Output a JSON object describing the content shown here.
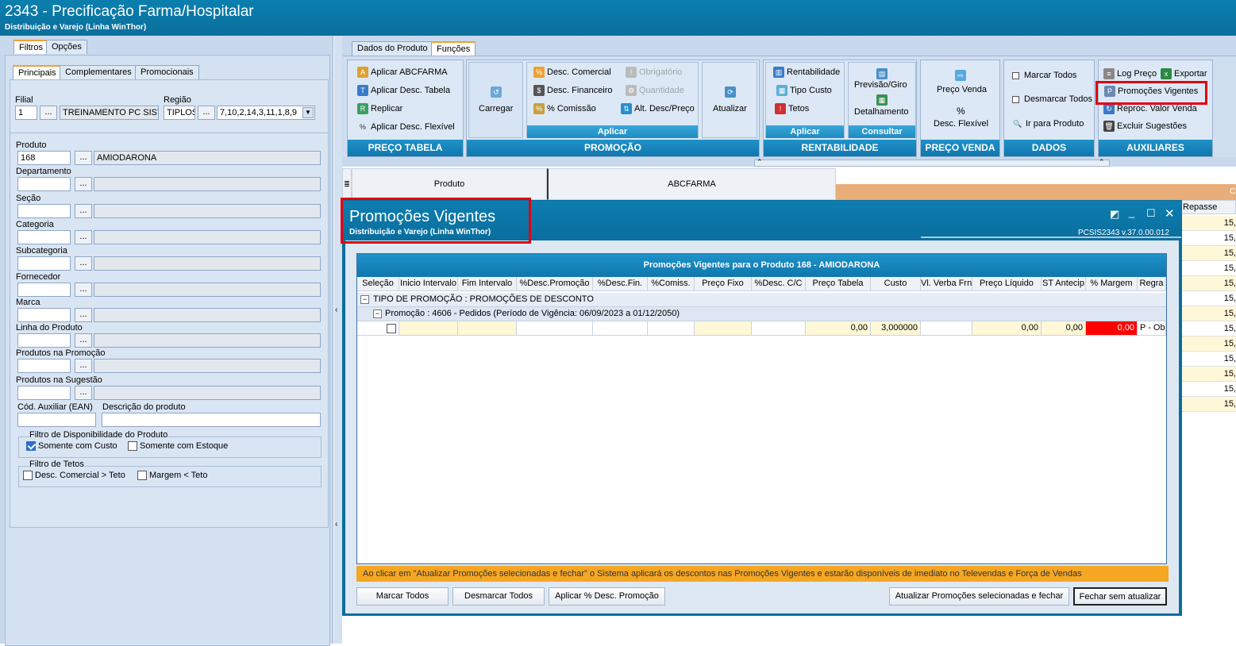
{
  "window": {
    "title": "2343 - Precificação Farma/Hospitalar",
    "subtitle": "Distribuição e Varejo (Linha WinThor)"
  },
  "left": {
    "top_tabs": [
      "Filtros",
      "Opções"
    ],
    "sub_tabs": [
      "Principais",
      "Complementares",
      "Promocionais"
    ],
    "filial_label": "Filial",
    "filial_value": "1",
    "filial_name": "TREINAMENTO PC SISTEI",
    "regiao_label": "Região",
    "regiao_value": "TIPLOS",
    "regiao_list": "7,10,2,14,3,11,1,8,9",
    "fields": [
      {
        "label": "Produto",
        "code": "168",
        "desc": "AMIODARONA"
      },
      {
        "label": "Departamento",
        "code": "",
        "desc": ""
      },
      {
        "label": "Seção",
        "code": "",
        "desc": ""
      },
      {
        "label": "Categoria",
        "code": "",
        "desc": ""
      },
      {
        "label": "Subcategoria",
        "code": "",
        "desc": ""
      },
      {
        "label": "Fornecedor",
        "code": "",
        "desc": ""
      },
      {
        "label": "Marca",
        "code": "",
        "desc": ""
      },
      {
        "label": "Linha do Produto",
        "code": "",
        "desc": ""
      },
      {
        "label": "Produtos na Promoção",
        "code": "",
        "desc": ""
      },
      {
        "label": "Produtos na Sugestão",
        "code": "",
        "desc": ""
      }
    ],
    "ean_label": "Cód. Auxiliar (EAN)",
    "descprod_label": "Descrição do produto",
    "disp_title": "Filtro de Disponibilidade do Produto",
    "disp_custo": "Somente com Custo",
    "disp_estoque": "Somente com Estoque",
    "tetos_title": "Filtro de Tetos",
    "teto_desc": "Desc.  Comercial > Teto",
    "teto_margem": "Margem < Teto",
    "dots": "..."
  },
  "ribbon": {
    "tabs": [
      "Dados do Produto",
      "Funções"
    ],
    "preco_tabela": {
      "footer": "PREÇO TABELA",
      "items": [
        "Aplicar ABCFARMA",
        "Aplicar Desc. Tabela",
        "Replicar",
        "Aplicar Desc. Flexível"
      ]
    },
    "promocao": {
      "footer": "PROMOÇÃO",
      "carregar": "Carregar",
      "sub": "Aplicar",
      "items": [
        "Desc. Comercial",
        "Desc. Financeiro",
        "% Comissão"
      ],
      "items2": [
        "Obrigatório",
        "Quantidade",
        "Alt. Desc/Preço"
      ],
      "atualizar": "Atualizar"
    },
    "rentab": {
      "footer": "RENTABILIDADE",
      "sub": "Aplicar",
      "items": [
        "Rentabilidade",
        "Tipo Custo",
        "Tetos"
      ],
      "sub2": "Consultar",
      "prev": "Previsão/Giro",
      "det": "Detalhamento"
    },
    "preco_venda": {
      "footer": "PREÇO VENDA",
      "items": [
        "Preço Venda",
        "Desc. Flexível"
      ]
    },
    "dados": {
      "footer": "DADOS",
      "items": [
        "Marcar Todos",
        "Desmarcar Todos",
        "Ir para Produto"
      ]
    },
    "aux": {
      "footer": "AUXILIARES",
      "items": [
        "Log Preço",
        "Exportar",
        "Promoções Vigentes",
        "Reproc. Valor Venda",
        "Excluir Sugestões"
      ]
    }
  },
  "grid": {
    "col_produto": "Produto",
    "col_abc": "ABCFARMA",
    "col_repasse": "Repasse",
    "col_c": "C",
    "repasse_values": [
      "15,",
      "15,",
      "15,",
      "15,",
      "15,",
      "15,",
      "15,",
      "15,",
      "15,",
      "15,",
      "15,",
      "15,",
      "15,"
    ]
  },
  "modal": {
    "title": "Promoções Vigentes",
    "subtitle": "Distribuição e Varejo (Linha WinThor)",
    "version": "PCSIS2343  v.37.0.00.012",
    "grid_title": "Promoções Vigentes para o Produto 168 - AMIODARONA",
    "columns": [
      "Seleção",
      "Inicio Intervalo",
      "Fim Intervalo",
      "%Desc.Promoção",
      "%Desc.Fin.",
      "%Comiss.",
      "Preço Fixo",
      "%Desc. C/C",
      "Preço Tabela",
      "Custo",
      "Vl. Verba Frn",
      "Preço Líquido",
      "ST Antecip",
      "% Margem",
      "Regra"
    ],
    "group1": "TIPO DE PROMOÇÃO : PROMOÇÕES DE DESCONTO",
    "group2": "Promoção : 4606 - Pedidos (Período de Vigência: 06/09/2023 a 01/12/2050)",
    "row": {
      "preco_tabela": "0,00",
      "custo": "3,000000",
      "preco_liquido": "0,00",
      "st": "0,00",
      "margem": "0,00",
      "regra": "P - Ob"
    },
    "notice": "Ao clicar em \"Atualizar Promoções selecionadas e fechar\" o Sistema aplicará os descontos nas Promoções Vigentes e estarão disponíveis de imediato no Televendas e Força de Vendas",
    "buttons": {
      "marcar": "Marcar Todos",
      "desmarcar": "Desmarcar Todos",
      "aplicar": "Aplicar % Desc. Promoção",
      "atualizar": "Atualizar Promoções selecionadas e fechar",
      "fechar": "Fechar sem atualizar"
    }
  },
  "colors": {
    "title_bar": "#0a7fae",
    "highlight": "#e3000f",
    "orange": "#f5a623",
    "margem_red": "#ff0000",
    "cell_yellow": "#fff8d8"
  }
}
